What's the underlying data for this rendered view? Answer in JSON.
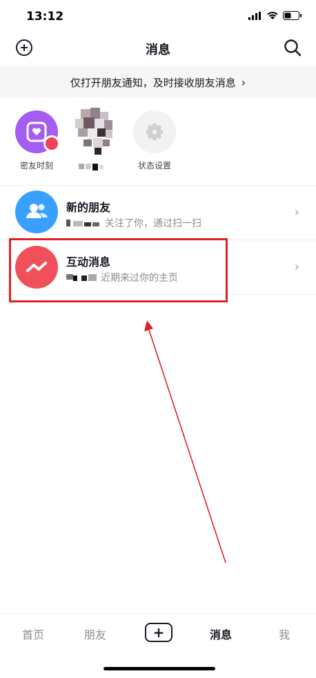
{
  "status_bar": {
    "time": "13:12"
  },
  "header": {
    "title": "消息"
  },
  "banner": {
    "text": "仅打开朋友通知，及时接收朋友消息",
    "chevron": "›"
  },
  "stories": [
    {
      "label": "密友时刻",
      "icon": "heart-frame-icon",
      "color": "#a55cf0"
    },
    {
      "label": "",
      "icon": "blurred-avatar",
      "color": "#9a8e8a"
    },
    {
      "label": "状态设置",
      "icon": "gear-icon",
      "color": "#f2f2f2"
    }
  ],
  "rows": [
    {
      "title": "新的朋友",
      "subtitle": "关注了你，通过扫一扫",
      "icon": "people-icon",
      "color": "#3aa0ff"
    },
    {
      "title": "互动消息",
      "subtitle": "近期来过你的主页",
      "icon": "zigzag-icon",
      "color": "#f0505a"
    }
  ],
  "bottom_nav": {
    "items": [
      {
        "label": "首页",
        "active": false
      },
      {
        "label": "朋友",
        "active": false
      },
      {
        "label": "+",
        "active": false
      },
      {
        "label": "消息",
        "active": true
      },
      {
        "label": "我",
        "active": false
      }
    ]
  },
  "annotation_color": "#e02020"
}
